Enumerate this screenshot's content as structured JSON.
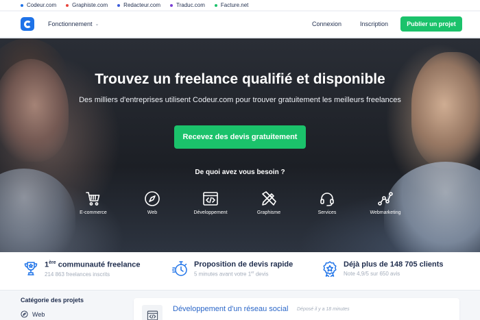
{
  "network": {
    "sites": [
      {
        "label": "Codeur.com",
        "color": "#1f73e8"
      },
      {
        "label": "Graphiste.com",
        "color": "#e8453c"
      },
      {
        "label": "Redacteur.com",
        "color": "#3a5bd9"
      },
      {
        "label": "Traduc.com",
        "color": "#7b3fd4"
      },
      {
        "label": "Facture.net",
        "color": "#1bc26b"
      }
    ]
  },
  "header": {
    "menu_label": "Fonctionnement",
    "login_label": "Connexion",
    "signup_label": "Inscription",
    "publish_label": "Publier un projet"
  },
  "hero": {
    "title": "Trouvez un freelance qualifié et disponible",
    "subtitle": "Des milliers d'entreprises utilisent Codeur.com pour trouver gratuitement les meilleurs freelances",
    "cta_label": "Recevez des devis gratuitement",
    "question": "De quoi avez vous besoin ?",
    "categories": [
      {
        "label": "E-commerce",
        "icon": "cart-icon"
      },
      {
        "label": "Web",
        "icon": "compass-icon"
      },
      {
        "label": "Développement",
        "icon": "code-window-icon"
      },
      {
        "label": "Graphisme",
        "icon": "pen-ruler-icon"
      },
      {
        "label": "Services",
        "icon": "headset-icon"
      },
      {
        "label": "Webmarketing",
        "icon": "network-icon"
      }
    ]
  },
  "stats": [
    {
      "title_pre": "1",
      "title_sup": "ère",
      "title_post": " communauté freelance",
      "sub_pre": "214 863 freelances inscrits",
      "sub_sup": "",
      "sub_post": "",
      "icon": "trophy-icon"
    },
    {
      "title_pre": "Proposition de devis rapide",
      "title_sup": "",
      "title_post": "",
      "sub_pre": "5 minutes avant votre 1",
      "sub_sup": "er",
      "sub_post": " devis",
      "icon": "stopwatch-icon"
    },
    {
      "title_pre": "Déjà plus de 148 705 clients",
      "title_sup": "",
      "title_post": "",
      "sub_pre": "Note 4,9/5 sur 650 avis",
      "sub_sup": "",
      "sub_post": "",
      "icon": "badge-icon"
    }
  ],
  "sidebar": {
    "title": "Catégorie des projets",
    "items": [
      {
        "label": "Web",
        "icon": "compass-icon"
      }
    ]
  },
  "project": {
    "title": "Développement d'un réseau social",
    "meta": "Déposé il y a 18 minutes",
    "icon": "code-window-icon"
  },
  "colors": {
    "accent_green": "#1bc26b",
    "brand_blue": "#1f73e8",
    "link_blue": "#2a66c8"
  }
}
